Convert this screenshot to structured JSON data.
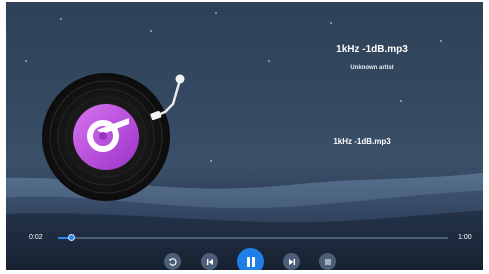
{
  "track": {
    "title": "1kHz -1dB.mp3",
    "artist": "Unknown artist",
    "lyric": "1kHz -1dB.mp3"
  },
  "progress": {
    "current_time": "0:02",
    "total_time": "1:00",
    "fraction": 0.033
  },
  "controls": {
    "repeat": "repeat-icon",
    "previous": "previous-icon",
    "play_pause": "pause-icon",
    "next": "next-icon",
    "playlist": "playlist-icon"
  },
  "colors": {
    "accent": "#1f7fe6",
    "disc_label": "#c04ee0"
  }
}
